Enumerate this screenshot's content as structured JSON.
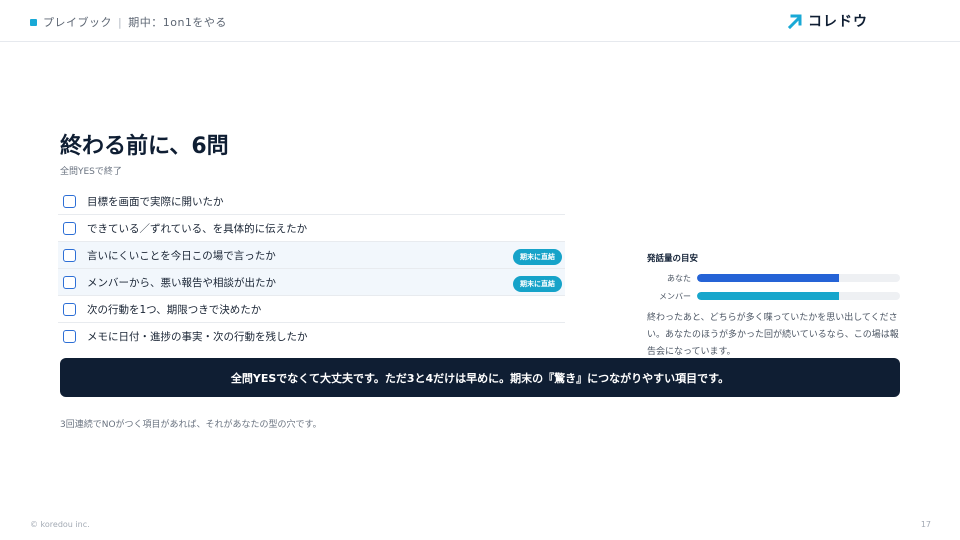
{
  "header": {
    "crumb_main": "プレイブック",
    "crumb_sep": "|",
    "crumb_sub": "期中：1on1をやる",
    "brand_name": "コレドウ",
    "brand_mark_color": "#19a9d6"
  },
  "title": "終わる前に、6問",
  "subtitle": "全問YESで終了",
  "checklist": [
    {
      "label": "目標を画面で実際に開いたか",
      "badge": ""
    },
    {
      "label": "できている／ずれている、を具体的に伝えたか",
      "badge": ""
    },
    {
      "label": "言いにくいことを今日この場で言ったか",
      "badge": "期末に直結"
    },
    {
      "label": "メンバーから、悪い報告や相談が出たか",
      "badge": "期末に直結"
    },
    {
      "label": "次の行動を1つ、期限つきで決めたか",
      "badge": ""
    },
    {
      "label": "メモに日付・進捗の事実・次の行動を残したか",
      "badge": ""
    }
  ],
  "speaking": {
    "title": "発話量の目安",
    "bars": [
      {
        "label": "あなた",
        "share": 0.7,
        "color": "#2563d6"
      },
      {
        "label": "メンバー",
        "share": 0.7,
        "color": "#17a6cc"
      }
    ],
    "note": "終わったあと、どちらが多く喋っていたかを思い出してください。あなたのほうが多かった回が続いているなら、この場は報告会になっています。"
  },
  "banner": "全問YESでなくて大丈夫です。ただ3と4だけは早めに。期末の『驚き』につながりやすい項目です。",
  "footnote": "3回連続でNOがつく項目があれば、それがあなたの型の穴です。",
  "footer": {
    "copyright": "© koredou inc.",
    "page_number": "17"
  }
}
